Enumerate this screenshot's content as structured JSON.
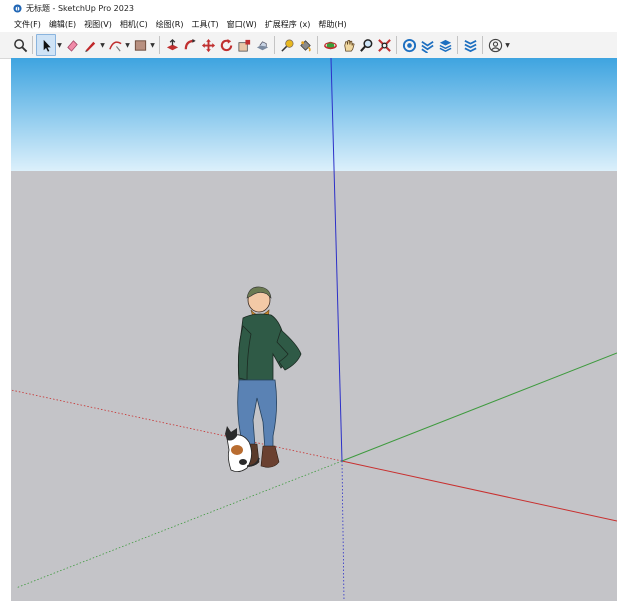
{
  "window": {
    "title": "无标题 - SketchUp Pro 2023"
  },
  "menu": {
    "items": [
      "文件(F)",
      "编辑(E)",
      "视图(V)",
      "相机(C)",
      "绘图(R)",
      "工具(T)",
      "窗口(W)",
      "扩展程序 (x)",
      "帮助(H)"
    ]
  },
  "toolbar": {
    "tools": [
      "search-icon",
      "select-arrow-icon",
      "eraser-icon",
      "pencil-line-icon",
      "arc-icon",
      "rectangle-shape-icon",
      "push-pull-icon",
      "follow-me-icon",
      "move-icon",
      "rotate-icon",
      "scale-icon",
      "offset-icon",
      "tape-measure-icon",
      "paint-bucket-icon",
      "orbit-icon",
      "pan-icon",
      "zoom-icon",
      "zoom-extents-icon",
      "3d-warehouse-icon",
      "extension-warehouse-icon",
      "layout-icon",
      "extension-manager-icon",
      "user-account-icon"
    ]
  },
  "colors": {
    "sky_top": "#3ea4e0",
    "sky_bottom": "#dcf0fb",
    "ground": "#c4c4c8",
    "axis_red": "#c8302f",
    "axis_green": "#3e9a3e",
    "axis_blue": "#2c30c8",
    "accent": "#0a64c8"
  }
}
